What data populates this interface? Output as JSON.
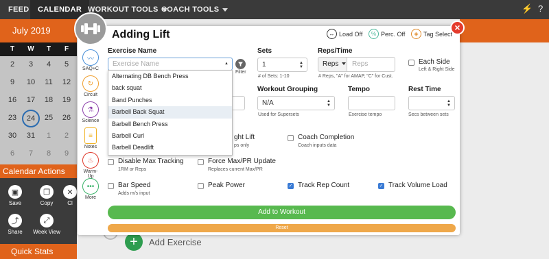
{
  "nav": {
    "items": [
      {
        "label": "FEED",
        "active": false
      },
      {
        "label": "CALENDAR",
        "active": true
      },
      {
        "label": "WORKOUT TOOLS",
        "active": false
      },
      {
        "label": "COACH TOOLS",
        "active": false
      }
    ],
    "icons": [
      "bolt-icon",
      "help-icon"
    ]
  },
  "calendar": {
    "month": "July 2019",
    "weekdays": [
      "T",
      "W",
      "T",
      "F"
    ],
    "rows": [
      [
        "2",
        "3",
        "4",
        "5"
      ],
      [
        "9",
        "10",
        "11",
        "12"
      ],
      [
        "16",
        "17",
        "18",
        "19"
      ],
      [
        "23",
        "24",
        "25",
        "26"
      ],
      [
        "30",
        "31",
        "1",
        "2"
      ],
      [
        "6",
        "7",
        "8",
        "9"
      ]
    ],
    "today": "24"
  },
  "calendar_actions": {
    "title": "Calendar Actions",
    "items": [
      {
        "label": "Save",
        "icon": "save-icon"
      },
      {
        "label": "Copy",
        "icon": "copy-icon"
      },
      {
        "label": "Cl",
        "icon": "clear-icon"
      },
      {
        "label": "Share",
        "icon": "share-icon"
      },
      {
        "label": "Week View",
        "icon": "week-view-icon"
      }
    ]
  },
  "quick_stats": {
    "title": "Quick Stats"
  },
  "background": {
    "add_exercise": "Add Exercise"
  },
  "modal": {
    "title": "Adding Lift",
    "toggles": {
      "load": "Load Off",
      "perc": "Perc. Off",
      "tag": "Tag Select"
    },
    "rail": [
      {
        "label": "SAQ+C",
        "icon": "pulse-icon",
        "color": "#4a90d9"
      },
      {
        "label": "Circuit",
        "icon": "circuit-icon",
        "color": "#f0a030"
      },
      {
        "label": "Science",
        "icon": "flask-icon",
        "color": "#8e44ad"
      },
      {
        "label": "Notes",
        "icon": "notes-icon",
        "color": "#f0b429"
      },
      {
        "label": "Warm-Up",
        "icon": "flame-icon",
        "color": "#e03a2c"
      },
      {
        "label": "More",
        "icon": "more-icon",
        "color": "#3bb36a"
      }
    ],
    "exercise": {
      "label": "Exercise Name",
      "placeholder": "Exercise Name",
      "filter_label": "Filter",
      "options": [
        "Alternating DB Bench Press",
        "back squat",
        "Band Punches",
        "Barbell Back Squat",
        "Barbell Bench Press",
        "Barbell Curl",
        "Barbell Deadlift"
      ],
      "highlighted": "Barbell Back Squat"
    },
    "sets": {
      "label": "Sets",
      "value": "1",
      "help": "# of Sets: 1-10"
    },
    "reps": {
      "label": "Reps/Time",
      "unit": "Reps",
      "placeholder": "Reps",
      "help": "# Reps, \"A\" for AMAP, \"C\" for Cust."
    },
    "each_side": {
      "label": "Each Side",
      "help": "Left & Right Side"
    },
    "grouping": {
      "label": "Workout Grouping",
      "value": "N/A",
      "help": "Used for Supersets"
    },
    "tempo": {
      "label": "Tempo",
      "help": "Exercise tempo"
    },
    "rest": {
      "label": "Rest Time",
      "help": "Secs between sets"
    },
    "checks": {
      "bodyweight": {
        "label": "ght Lift",
        "help": "ps only"
      },
      "coach_completion": {
        "label": "Coach Completion",
        "help": "Coach inputs data"
      },
      "disable_max": {
        "label": "Disable Max Tracking",
        "help": "1RM or Reps"
      },
      "force_max": {
        "label": "Force Max/PR Update",
        "help": "Replaces current Max/PR"
      },
      "bar_speed": {
        "label": "Bar Speed",
        "help": "Adds m/s input"
      },
      "peak_power": {
        "label": "Peak Power"
      },
      "track_rep": {
        "label": "Track Rep Count",
        "checked": true
      },
      "track_volume": {
        "label": "Track Volume Load",
        "checked": true
      }
    },
    "add_button": "Add to Workout",
    "reset_button": "Reset"
  }
}
